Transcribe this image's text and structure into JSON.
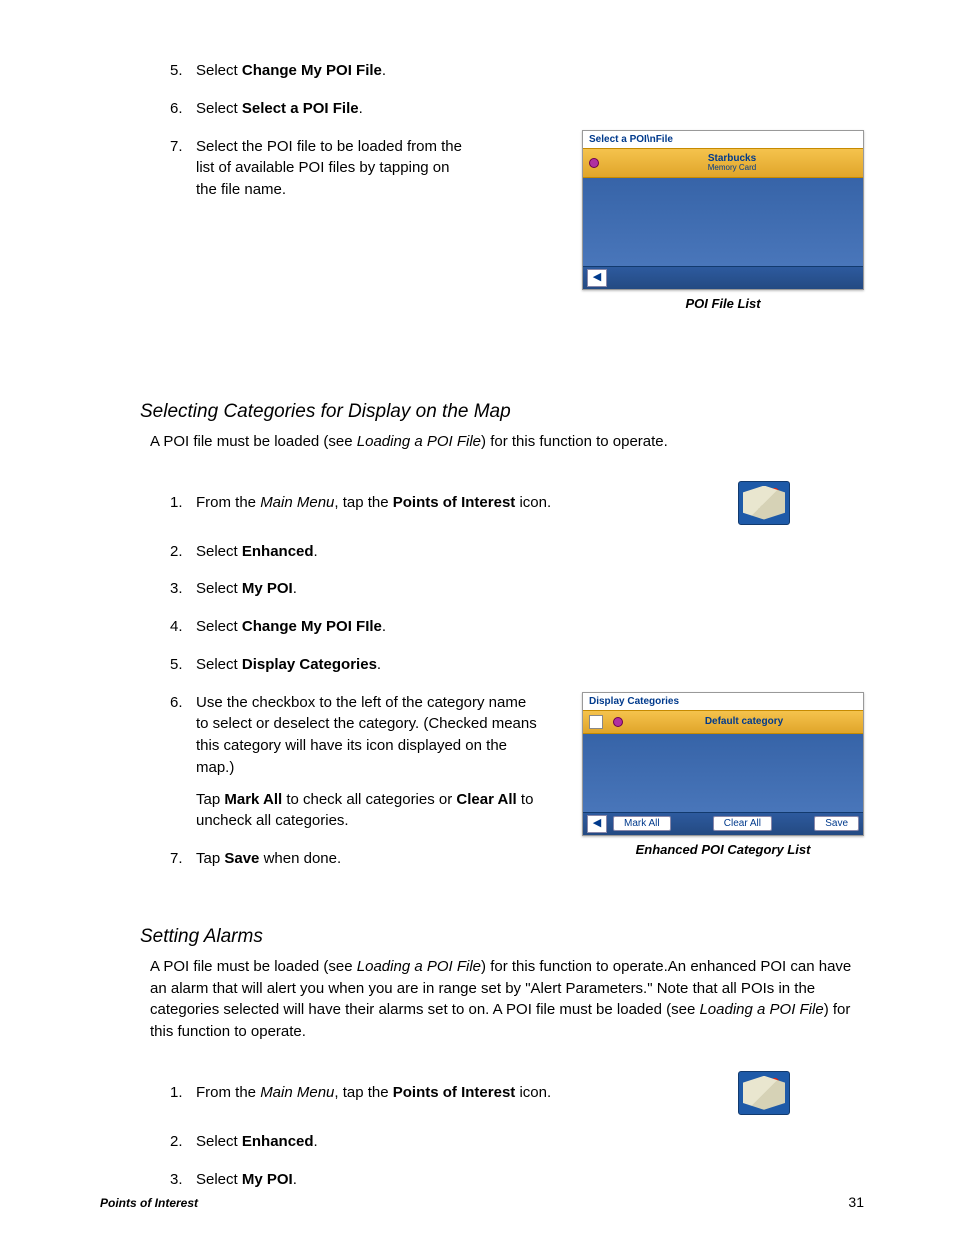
{
  "top_list": [
    {
      "num": "5.",
      "pre": "Select ",
      "bold": "Change My POI File",
      "post": "."
    },
    {
      "num": "6.",
      "pre": "Select ",
      "bold": "Select a POI File",
      "post": "."
    },
    {
      "num": "7.",
      "text": "Select the POI file to be loaded from the list of available POI files by tapping on the file name."
    }
  ],
  "fig1": {
    "title": "Select a POI\\nFile",
    "item_title": "Starbucks",
    "item_sub": "Memory Card",
    "caption": "POI File List"
  },
  "sec1": {
    "heading": "Selecting Categories for Display on the Map",
    "intro_pre": "A POI file must be loaded (see ",
    "intro_em": "Loading a POI File",
    "intro_post": ") for this function to operate.",
    "items": {
      "i1_pre": "From the ",
      "i1_em": "Main Menu",
      "i1_mid": ", tap the ",
      "i1_b": "Points of Interest",
      "i1_post": " icon.",
      "i2_pre": "Select ",
      "i2_b": "Enhanced",
      "i2_post": ".",
      "i3_pre": "Select ",
      "i3_b": "My POI",
      "i3_post": ".",
      "i4_pre": "Select ",
      "i4_b": "Change My POI FIle",
      "i4_post": ".",
      "i5_pre": "Select ",
      "i5_b": "Display Categories",
      "i5_post": ".",
      "i6": "Use the checkbox to the left of the category name to select or deselect the category. (Checked means this category will have its icon displayed on the map.)",
      "i6b_pre": "Tap ",
      "i6b_b1": "Mark All",
      "i6b_mid": " to check all categories or ",
      "i6b_b2": "Clear All",
      "i6b_post": " to uncheck all categories.",
      "i7_pre": "Tap ",
      "i7_b": "Save",
      "i7_post": " when done."
    }
  },
  "fig2": {
    "title": "Display Categories",
    "row_label": "Default category",
    "btn_mark": "Mark All",
    "btn_clear": "Clear All",
    "btn_save": "Save",
    "caption": "Enhanced POI Category List"
  },
  "sec2": {
    "heading": "Setting Alarms",
    "p1_pre": "A POI file must be loaded (see ",
    "p1_em": "Loading a POI File",
    "p1_mid": ") for this function to operate.An enhanced POI can have an alarm that will alert you when you are in range set by \"Alert Parameters.\"  Note that all POIs in the categories selected will have their alarms set to on.  A POI file must be loaded (see ",
    "p1_em2": "Loading a POI File",
    "p1_post": ") for this function to operate.",
    "items": {
      "i1_pre": "From the ",
      "i1_em": "Main Menu",
      "i1_mid": ", tap the ",
      "i1_b": "Points of Interest",
      "i1_post": " icon.",
      "i2_pre": "Select ",
      "i2_b": "Enhanced",
      "i2_post": ".",
      "i3_pre": "Select ",
      "i3_b": "My POI",
      "i3_post": "."
    }
  },
  "nums": {
    "n1": "1.",
    "n2": "2.",
    "n3": "3.",
    "n4": "4.",
    "n5": "5.",
    "n6": "6.",
    "n7": "7."
  },
  "footer": {
    "section": "Points of Interest",
    "page": "31"
  },
  "icons": {
    "back": "◀"
  }
}
